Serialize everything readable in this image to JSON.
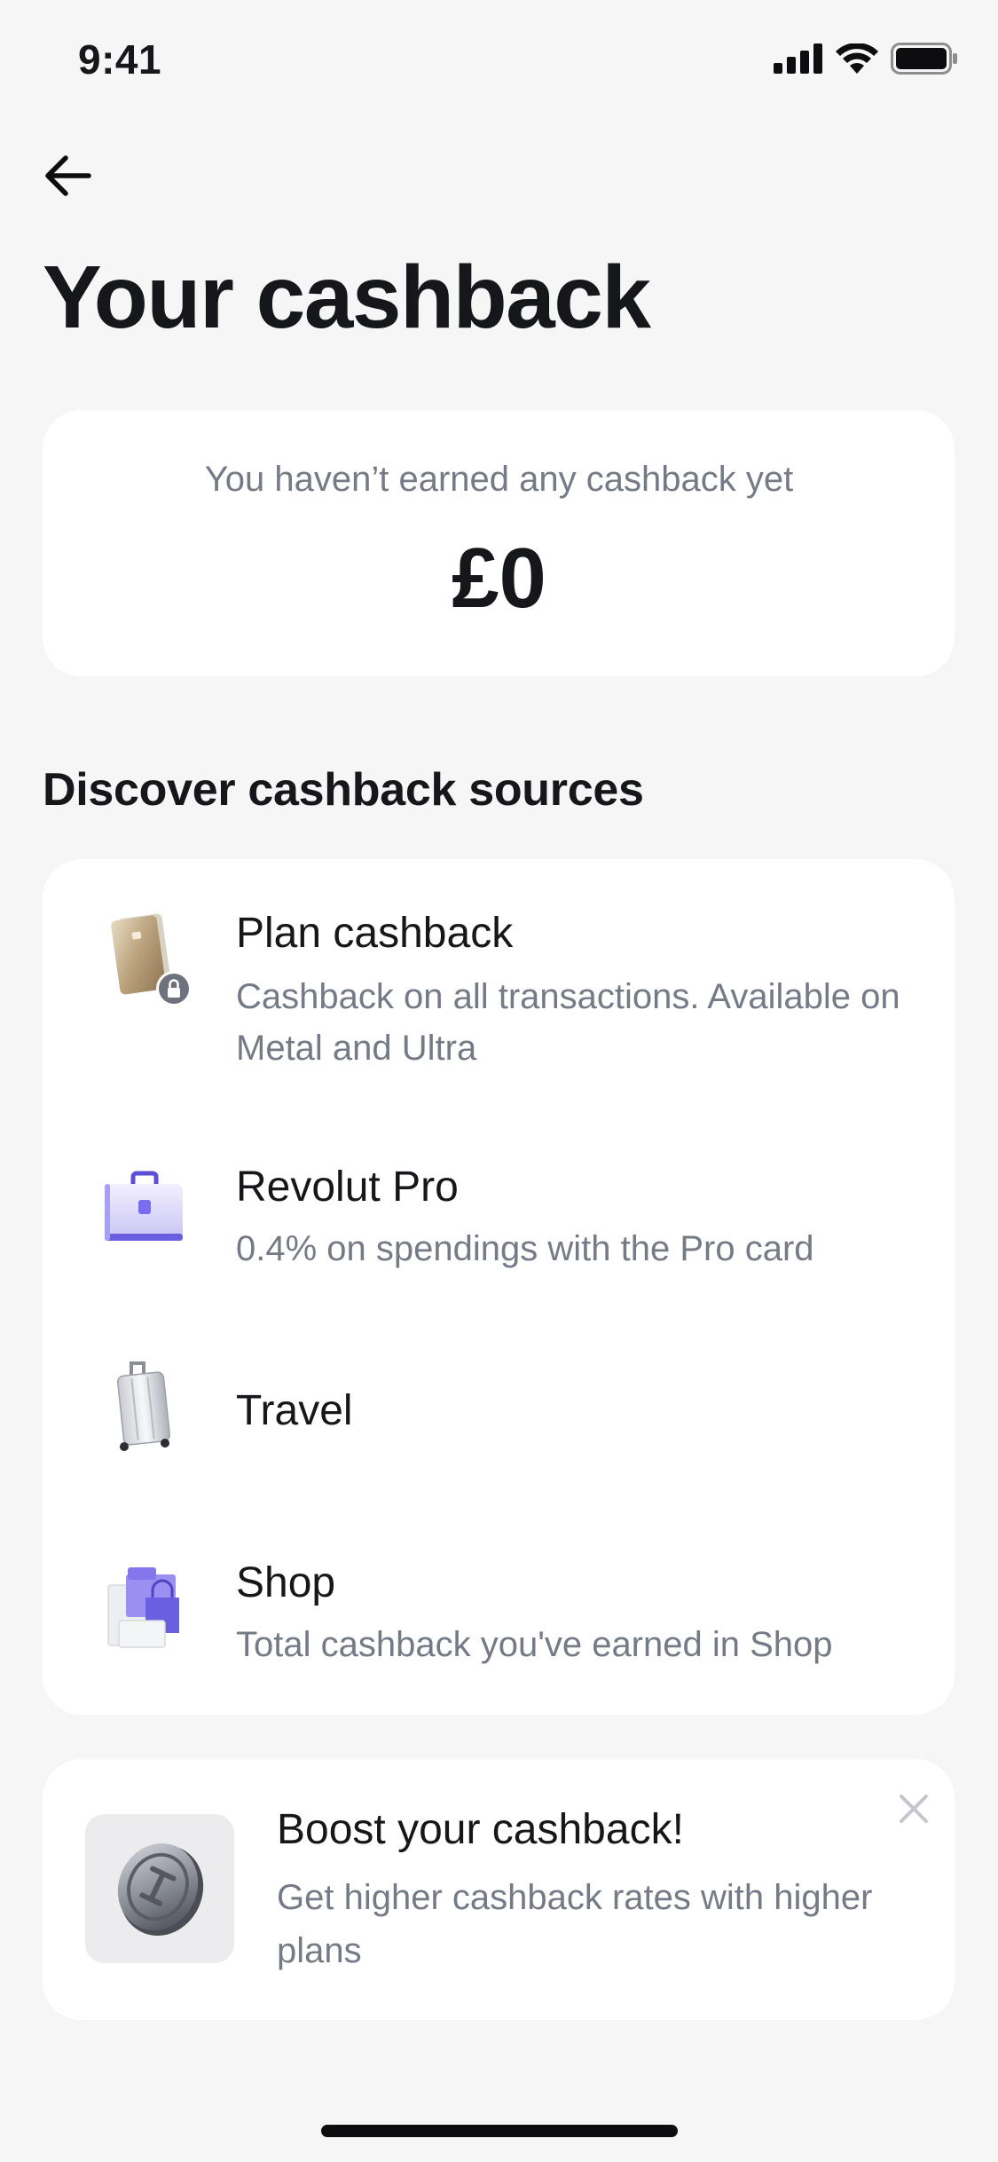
{
  "status_bar": {
    "time": "9:41"
  },
  "header": {
    "title": "Your cashback"
  },
  "summary": {
    "message": "You haven’t earned any cashback yet",
    "amount": "£0"
  },
  "sources": {
    "heading": "Discover cashback sources",
    "items": [
      {
        "title": "Plan cashback",
        "description": "Cashback on all transactions. Available on Metal and Ultra",
        "icon": "metal-card-icon"
      },
      {
        "title": "Revolut Pro",
        "description": "0.4% on spendings with the Pro card",
        "icon": "briefcase-icon"
      },
      {
        "title": "Travel",
        "description": "",
        "icon": "suitcase-icon"
      },
      {
        "title": "Shop",
        "description": "Total cashback you've earned in Shop",
        "icon": "shopping-bag-icon"
      }
    ]
  },
  "boost": {
    "title": "Boost your cashback!",
    "description": "Get higher cashback rates with higher plans",
    "icon": "coin-icon"
  },
  "colors": {
    "background": "#f6f6f7",
    "card": "#ffffff",
    "text_primary": "#16171a",
    "text_secondary": "#757b86",
    "accent_purple": "#7b6cf0"
  }
}
